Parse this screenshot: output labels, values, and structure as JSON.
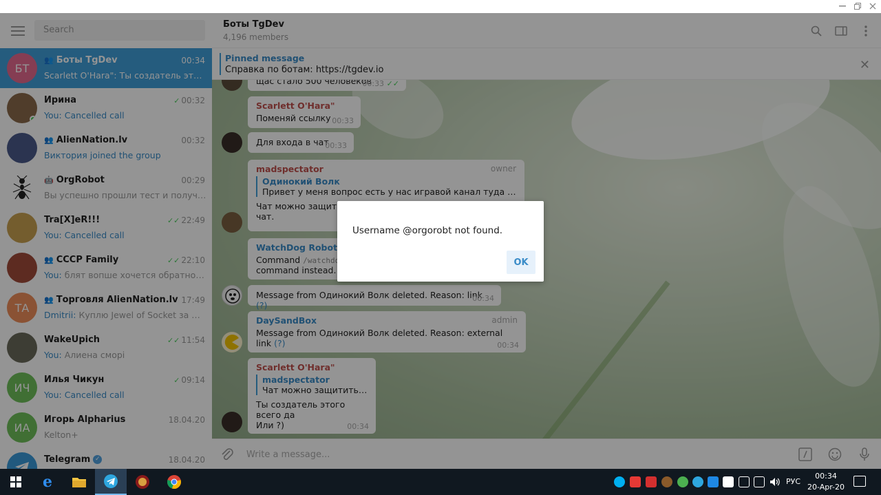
{
  "window": {
    "controls": [
      "minimize",
      "maximize",
      "close"
    ]
  },
  "sidebar": {
    "search_placeholder": "Search",
    "chats": [
      {
        "name": "Боты TgDev",
        "time": "00:34",
        "preview": "Scarlett O'Hara\": Ты создатель этого вс...",
        "initials": "БТ",
        "color": "#e56a8f",
        "group": true
      },
      {
        "name": "Ирина",
        "time": "00:32",
        "prefix": "You: ",
        "preview": "Cancelled call",
        "color": "#8a6a4a",
        "read": true,
        "online": true
      },
      {
        "name": "AlienNation.lv",
        "time": "00:32",
        "preview": "Виктория joined the group",
        "color": "#4a5a8a",
        "group": true,
        "system": true
      },
      {
        "name": "OrgRobot",
        "time": "00:29",
        "preview": "Вы успешно прошли тест и получили ...",
        "color": "#ffffff",
        "bot": true
      },
      {
        "name": "Tra[X]eR!!!",
        "time": "22:49",
        "prefix": "You: ",
        "preview": "Cancelled call",
        "color": "#c8a050",
        "read": true
      },
      {
        "name": "СССР Family",
        "time": "22:10",
        "prefix": "You: ",
        "preview": "блят вопше хочется обратно в По...",
        "color": "#a04a3a",
        "read": true,
        "group": true
      },
      {
        "name": "Торговля AlienNation.lv",
        "time": "17:49",
        "prefix": "Dmitrii: ",
        "preview": "Куплю Jewel of Socket за WMZ/P...",
        "initials": "ТА",
        "color": "#ee8e5a",
        "group": true
      },
      {
        "name": "WakeUpich",
        "time": "11:54",
        "prefix": "You: ",
        "preview": "Алиена сморі",
        "color": "#6a6a5a",
        "read": true
      },
      {
        "name": "Илья Чикун",
        "time": "09:14",
        "prefix": "You: ",
        "preview": "Cancelled call",
        "initials": "ИЧ",
        "color": "#6ec05a",
        "read": true
      },
      {
        "name": "Игорь Alpharius",
        "time": "18.04.20",
        "preview": "Kelton+",
        "initials": "ИА",
        "color": "#6ec05a"
      },
      {
        "name": "Telegram",
        "time": "18.04.20",
        "preview": "",
        "color": "#3a9ad9",
        "verified": true
      }
    ]
  },
  "chat": {
    "title": "Боты TgDev",
    "members": "4,196 members",
    "pinned": {
      "title": "Pinned message",
      "text": "Справка по ботам: https://tgdev.io"
    },
    "messages": {
      "m0": {
        "text": "щас стало 500 человеков",
        "time": "00:33"
      },
      "m1": {
        "author": "Scarlett O'Hara\"",
        "text": "Поменяй ссылку",
        "time": "00:33"
      },
      "m2": {
        "text": "Для входа в чат",
        "time": "00:33"
      },
      "m3": {
        "author": "madspectator",
        "role": "owner",
        "reply_name": "Одинокий Волк",
        "reply_text": "Привет у меня вопрос есть у нас игравой канал туда Добавлю...",
        "text_a": "Чат можно защитить",
        "text_b": "чат."
      },
      "m4": {
        "author": "WatchDog Robot",
        "text_a": "Command",
        "code": "/watchdog",
        "text_b": "command instead."
      },
      "m5": {
        "text": "Message from Одинокий Волк deleted. Reason: link",
        "link": "(?)",
        "time": "00:34"
      },
      "m6": {
        "author": "DaySandBox",
        "role": "admin",
        "text": "Message from Одинокий Волк deleted. Reason: external link",
        "link": "(?)",
        "time": "00:34"
      },
      "m7": {
        "author": "Scarlett O'Hara\"",
        "reply_name": "madspectator",
        "reply_text": "Чат можно защитить с п...",
        "line1": "Ты создатель этого всего да",
        "line2": "Или ?)",
        "time": "00:34"
      }
    },
    "composer_placeholder": "Write a message..."
  },
  "dialog": {
    "message": "Username @orgorobt not found.",
    "ok": "OK"
  },
  "taskbar": {
    "lang": "РУС",
    "time": "00:34",
    "date": "20-Apr-20"
  }
}
